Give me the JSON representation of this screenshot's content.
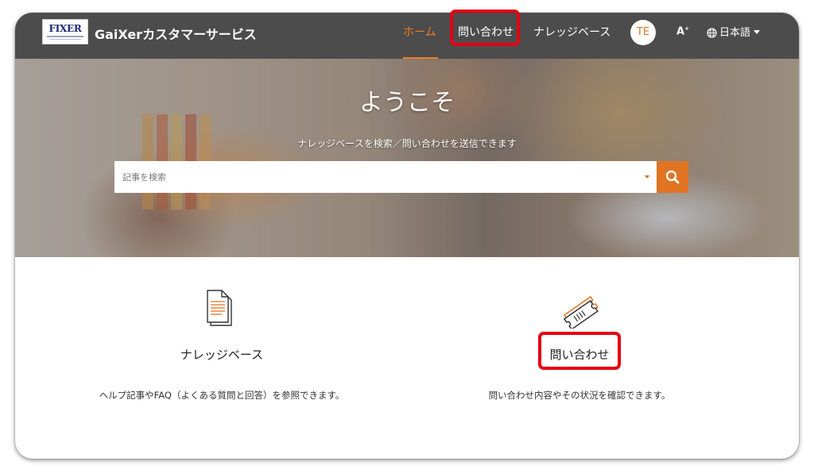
{
  "header": {
    "logo_text": "FIXER",
    "brand": "GaiXerカスタマーサービス",
    "nav": {
      "home": "ホーム",
      "contact": "問い合わせ",
      "knowledge_base": "ナレッジベース"
    },
    "avatar_initials": "TE",
    "text_size_label": "A",
    "text_size_sup": "+",
    "language": "日本語"
  },
  "hero": {
    "title": "ようこそ",
    "subtitle": "ナレッジベースを検索／問い合わせを送信できます",
    "search_placeholder": "記事を検索"
  },
  "cards": {
    "knowledge_base": {
      "title": "ナレッジベース",
      "description": "ヘルプ記事やFAQ（よくある質問と回答）を参照できます。"
    },
    "contact": {
      "title": "問い合わせ",
      "description": "問い合わせ内容やその状況を確認できます。"
    }
  },
  "colors": {
    "accent": "#e07422",
    "header_bg": "#3e3e3e",
    "highlight": "#e60012"
  }
}
